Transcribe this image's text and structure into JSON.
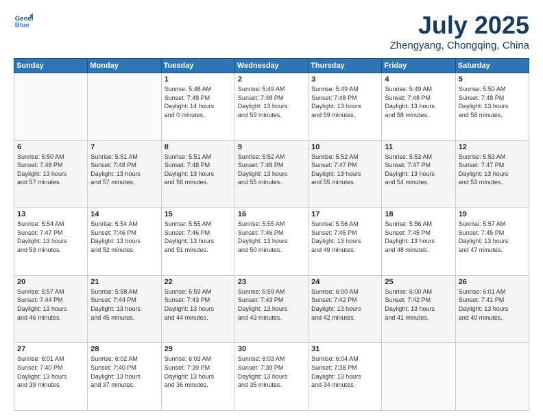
{
  "header": {
    "logo_line1": "General",
    "logo_line2": "Blue",
    "title": "July 2025",
    "subtitle": "Zhengyang, Chongqing, China"
  },
  "weekdays": [
    "Sunday",
    "Monday",
    "Tuesday",
    "Wednesday",
    "Thursday",
    "Friday",
    "Saturday"
  ],
  "weeks": [
    [
      {
        "day": "",
        "info": ""
      },
      {
        "day": "",
        "info": ""
      },
      {
        "day": "1",
        "info": "Sunrise: 5:48 AM\nSunset: 7:48 PM\nDaylight: 14 hours\nand 0 minutes."
      },
      {
        "day": "2",
        "info": "Sunrise: 5:49 AM\nSunset: 7:48 PM\nDaylight: 13 hours\nand 59 minutes."
      },
      {
        "day": "3",
        "info": "Sunrise: 5:49 AM\nSunset: 7:48 PM\nDaylight: 13 hours\nand 59 minutes."
      },
      {
        "day": "4",
        "info": "Sunrise: 5:49 AM\nSunset: 7:48 PM\nDaylight: 13 hours\nand 58 minutes."
      },
      {
        "day": "5",
        "info": "Sunrise: 5:50 AM\nSunset: 7:48 PM\nDaylight: 13 hours\nand 58 minutes."
      }
    ],
    [
      {
        "day": "6",
        "info": "Sunrise: 5:50 AM\nSunset: 7:48 PM\nDaylight: 13 hours\nand 57 minutes."
      },
      {
        "day": "7",
        "info": "Sunrise: 5:51 AM\nSunset: 7:48 PM\nDaylight: 13 hours\nand 57 minutes."
      },
      {
        "day": "8",
        "info": "Sunrise: 5:51 AM\nSunset: 7:48 PM\nDaylight: 13 hours\nand 56 minutes."
      },
      {
        "day": "9",
        "info": "Sunrise: 5:52 AM\nSunset: 7:48 PM\nDaylight: 13 hours\nand 55 minutes."
      },
      {
        "day": "10",
        "info": "Sunrise: 5:52 AM\nSunset: 7:47 PM\nDaylight: 13 hours\nand 55 minutes."
      },
      {
        "day": "11",
        "info": "Sunrise: 5:53 AM\nSunset: 7:47 PM\nDaylight: 13 hours\nand 54 minutes."
      },
      {
        "day": "12",
        "info": "Sunrise: 5:53 AM\nSunset: 7:47 PM\nDaylight: 13 hours\nand 53 minutes."
      }
    ],
    [
      {
        "day": "13",
        "info": "Sunrise: 5:54 AM\nSunset: 7:47 PM\nDaylight: 13 hours\nand 53 minutes."
      },
      {
        "day": "14",
        "info": "Sunrise: 5:54 AM\nSunset: 7:46 PM\nDaylight: 13 hours\nand 52 minutes."
      },
      {
        "day": "15",
        "info": "Sunrise: 5:55 AM\nSunset: 7:46 PM\nDaylight: 13 hours\nand 51 minutes."
      },
      {
        "day": "16",
        "info": "Sunrise: 5:55 AM\nSunset: 7:46 PM\nDaylight: 13 hours\nand 50 minutes."
      },
      {
        "day": "17",
        "info": "Sunrise: 5:56 AM\nSunset: 7:45 PM\nDaylight: 13 hours\nand 49 minutes."
      },
      {
        "day": "18",
        "info": "Sunrise: 5:56 AM\nSunset: 7:45 PM\nDaylight: 13 hours\nand 48 minutes."
      },
      {
        "day": "19",
        "info": "Sunrise: 5:57 AM\nSunset: 7:45 PM\nDaylight: 13 hours\nand 47 minutes."
      }
    ],
    [
      {
        "day": "20",
        "info": "Sunrise: 5:57 AM\nSunset: 7:44 PM\nDaylight: 13 hours\nand 46 minutes."
      },
      {
        "day": "21",
        "info": "Sunrise: 5:58 AM\nSunset: 7:44 PM\nDaylight: 13 hours\nand 45 minutes."
      },
      {
        "day": "22",
        "info": "Sunrise: 5:59 AM\nSunset: 7:43 PM\nDaylight: 13 hours\nand 44 minutes."
      },
      {
        "day": "23",
        "info": "Sunrise: 5:59 AM\nSunset: 7:43 PM\nDaylight: 13 hours\nand 43 minutes."
      },
      {
        "day": "24",
        "info": "Sunrise: 6:00 AM\nSunset: 7:42 PM\nDaylight: 13 hours\nand 42 minutes."
      },
      {
        "day": "25",
        "info": "Sunrise: 6:00 AM\nSunset: 7:42 PM\nDaylight: 13 hours\nand 41 minutes."
      },
      {
        "day": "26",
        "info": "Sunrise: 6:01 AM\nSunset: 7:41 PM\nDaylight: 13 hours\nand 40 minutes."
      }
    ],
    [
      {
        "day": "27",
        "info": "Sunrise: 6:01 AM\nSunset: 7:40 PM\nDaylight: 13 hours\nand 39 minutes."
      },
      {
        "day": "28",
        "info": "Sunrise: 6:02 AM\nSunset: 7:40 PM\nDaylight: 13 hours\nand 37 minutes."
      },
      {
        "day": "29",
        "info": "Sunrise: 6:03 AM\nSunset: 7:39 PM\nDaylight: 13 hours\nand 36 minutes."
      },
      {
        "day": "30",
        "info": "Sunrise: 6:03 AM\nSunset: 7:39 PM\nDaylight: 13 hours\nand 35 minutes."
      },
      {
        "day": "31",
        "info": "Sunrise: 6:04 AM\nSunset: 7:38 PM\nDaylight: 13 hours\nand 34 minutes."
      },
      {
        "day": "",
        "info": ""
      },
      {
        "day": "",
        "info": ""
      }
    ]
  ]
}
